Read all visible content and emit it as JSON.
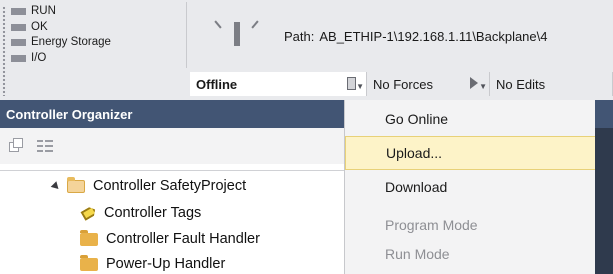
{
  "status_panel": {
    "items": [
      {
        "label": "RUN"
      },
      {
        "label": "OK"
      },
      {
        "label": "Energy Storage"
      },
      {
        "label": "I/O"
      }
    ]
  },
  "path": {
    "label": "Path:",
    "value": "AB_ETHIP-1\\192.168.1.11\\Backplane\\4"
  },
  "mode_bar": {
    "mode": "Offline",
    "forces": "No Forces",
    "edits": "No Edits"
  },
  "organizer": {
    "title": "Controller Organizer",
    "tree": [
      {
        "label": "Controller SafetyProject",
        "icon": "folder-open-icon"
      },
      {
        "label": "Controller Tags",
        "icon": "tag-icon"
      },
      {
        "label": "Controller Fault Handler",
        "icon": "folder-icon"
      },
      {
        "label": "Power-Up Handler",
        "icon": "folder-icon"
      }
    ]
  },
  "menu": {
    "items": [
      {
        "label": "Go Online",
        "enabled": true,
        "highlighted": false
      },
      {
        "label": "Upload...",
        "enabled": true,
        "highlighted": true
      },
      {
        "label": "Download",
        "enabled": true,
        "highlighted": false
      },
      {
        "label": "Program Mode",
        "enabled": false,
        "highlighted": false
      },
      {
        "label": "Run Mode",
        "enabled": false,
        "highlighted": false
      }
    ]
  },
  "colors": {
    "organizer_header": "#425574",
    "menu_highlight": "#fdf3c8",
    "disabled_text": "#8e8f94"
  }
}
